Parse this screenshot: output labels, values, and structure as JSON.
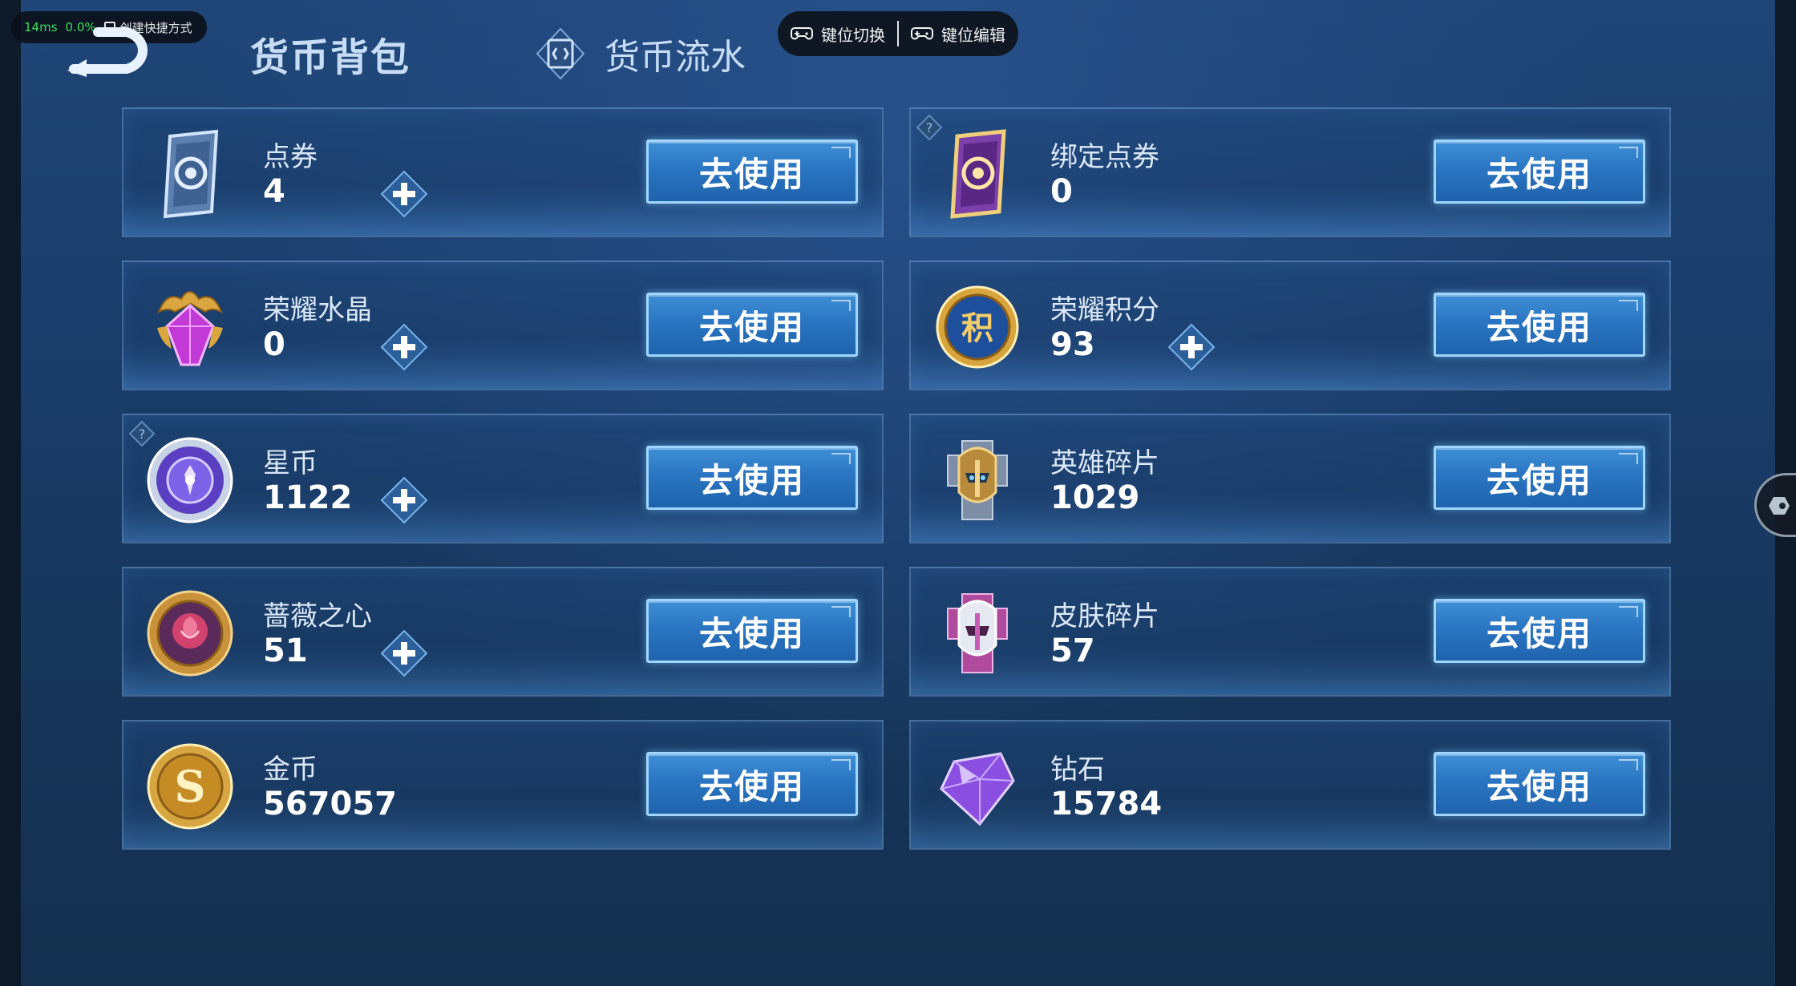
{
  "overlay": {
    "latency": "14ms",
    "percent": "0.0%",
    "shortcut_label": "创建快捷方式",
    "keymap_switch_label": "键位切换",
    "keymap_edit_label": "键位编辑"
  },
  "header": {
    "title": "货币背包",
    "flow_label": "货币流水"
  },
  "cards": [
    {
      "name": "点券",
      "amount": "4",
      "has_plus": true,
      "has_help": false,
      "icon": "voucher-icon"
    },
    {
      "name": "绑定点券",
      "amount": "0",
      "has_plus": false,
      "has_help": true,
      "icon": "bound-voucher-icon"
    },
    {
      "name": "荣耀水晶",
      "amount": "0",
      "has_plus": true,
      "has_help": false,
      "icon": "glory-crystal-icon"
    },
    {
      "name": "荣耀积分",
      "amount": "93",
      "has_plus": true,
      "has_help": false,
      "icon": "glory-points-icon"
    },
    {
      "name": "星币",
      "amount": "1122",
      "has_plus": true,
      "has_help": true,
      "icon": "star-coin-icon"
    },
    {
      "name": "英雄碎片",
      "amount": "1029",
      "has_plus": false,
      "has_help": false,
      "icon": "hero-shard-icon"
    },
    {
      "name": "蔷薇之心",
      "amount": "51",
      "has_plus": true,
      "has_help": false,
      "icon": "rose-heart-icon"
    },
    {
      "name": "皮肤碎片",
      "amount": "57",
      "has_plus": false,
      "has_help": false,
      "icon": "skin-shard-icon"
    },
    {
      "name": "金币",
      "amount": "567057",
      "has_plus": false,
      "has_help": false,
      "icon": "gold-coin-icon"
    },
    {
      "name": "钻石",
      "amount": "15784",
      "has_plus": false,
      "has_help": false,
      "icon": "diamond-icon"
    }
  ],
  "use_label": "去使用",
  "colors": {
    "accent": "#3e8fd6",
    "title": "#c7dcf5",
    "latency_green": "#3ddc63"
  }
}
